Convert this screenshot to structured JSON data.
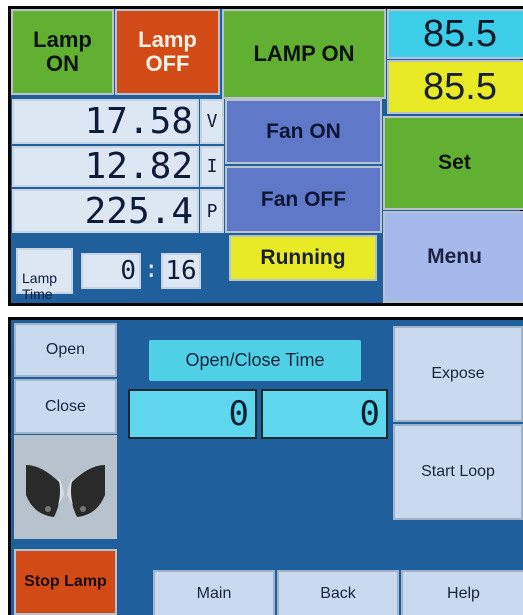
{
  "top": {
    "lamp_on_small": "Lamp\nON",
    "lamp_off_small": "Lamp\nOFF",
    "lamp_on_big": "LAMP ON",
    "setpoint_1": "85.5",
    "setpoint_2": "85.5",
    "voltage": "17.58",
    "voltage_unit": "V",
    "current": "12.82",
    "current_unit": "I",
    "power": "225.4",
    "power_unit": "P",
    "fan_on": "Fan ON",
    "fan_off": "Fan OFF",
    "set": "Set",
    "running": "Running",
    "menu": "Menu",
    "lamp_time_label": "Lamp\nTime",
    "lamp_time_hours": "0",
    "lamp_time_sep": ":",
    "lamp_time_minutes": "16"
  },
  "bottom": {
    "open": "Open",
    "close": "Close",
    "open_close_time_label": "Open/Close Time",
    "open_time_value": "0",
    "close_time_value": "0",
    "expose": "Expose",
    "start_loop": "Start Loop",
    "stop_lamp": "Stop Lamp",
    "main": "Main",
    "back": "Back",
    "help": "Help"
  },
  "colors": {
    "panel_bg": "#1f5f9c",
    "green": "#62b032",
    "orange": "#d24a16",
    "cyan": "#3ccde8",
    "yellow": "#e7ea24",
    "lavender": "#a5baeb",
    "light_button": "#c9d9ee"
  }
}
